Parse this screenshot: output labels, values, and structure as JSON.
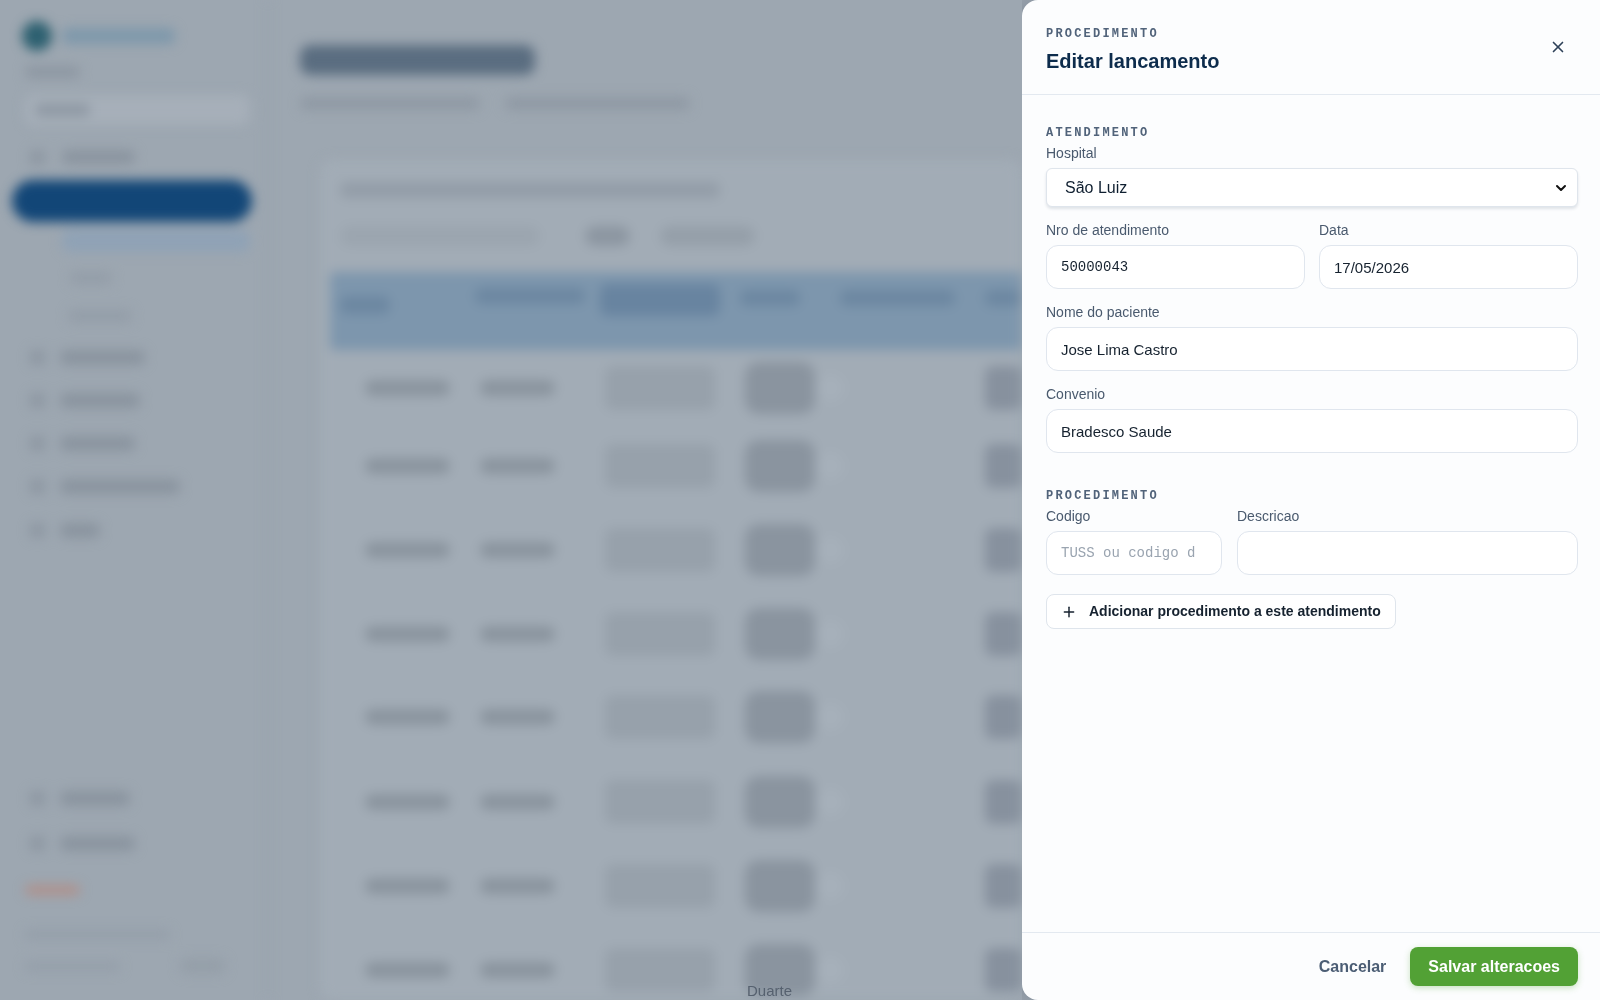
{
  "backdrop": {
    "visible_text": "Duarte"
  },
  "drawer": {
    "eyebrow": "PROCEDIMENTO",
    "title": "Editar lancamento",
    "sections": [
      {
        "heading": "ATENDIMENTO",
        "rows": [
          [
            {
              "kind": "select",
              "label": "Hospital",
              "value": "São Luiz"
            }
          ],
          [
            {
              "kind": "code",
              "label": "Nro de atendimento",
              "value": "50000043"
            },
            {
              "kind": "date",
              "label": "Data",
              "value": "17/05/2026"
            }
          ],
          [
            {
              "kind": "text",
              "label": "Nome do paciente",
              "value": "Jose Lima Castro"
            }
          ],
          [
            {
              "kind": "text",
              "label": "Convenio",
              "value": "Bradesco Saude"
            }
          ]
        ]
      },
      {
        "heading": "PROCEDIMENTO",
        "rows": [
          [
            {
              "kind": "code",
              "label": "Codigo",
              "placeholder": "TUSS ou codigo d"
            },
            {
              "kind": "text",
              "label": "Descricao"
            }
          ]
        ],
        "add_button": "Adicionar procedimento a este atendimento"
      }
    ],
    "footer_buttons": [
      {
        "kind": "secondary",
        "label": "Cancelar"
      },
      {
        "kind": "primary",
        "label": "Salvar alteracoes"
      }
    ]
  }
}
